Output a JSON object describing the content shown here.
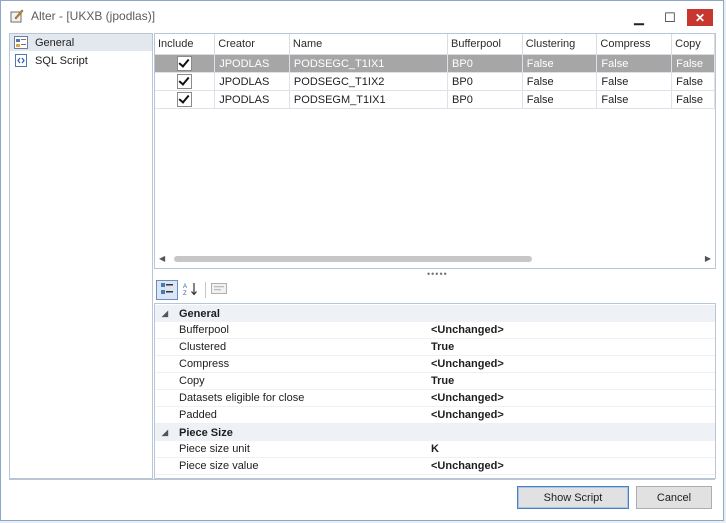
{
  "window": {
    "title": "Alter - [UKXB (jpodlas)]",
    "controls": {
      "minimize": "▁",
      "maximize": "☐",
      "close": "✕"
    }
  },
  "nav": {
    "items": [
      {
        "label": "General",
        "icon": "properties-icon",
        "selected": true
      },
      {
        "label": "SQL Script",
        "icon": "script-icon",
        "selected": false
      }
    ]
  },
  "grid": {
    "columns": [
      "Include",
      "Creator",
      "Name",
      "Bufferpool",
      "Clustering",
      "Compress",
      "Copy"
    ],
    "rows": [
      {
        "include": true,
        "creator": "JPODLAS",
        "name": "PODSEGC_T1IX1",
        "bufferpool": "BP0",
        "clustering": "False",
        "compress": "False",
        "copy": "False",
        "selected": true
      },
      {
        "include": true,
        "creator": "JPODLAS",
        "name": "PODSEGC_T1IX2",
        "bufferpool": "BP0",
        "clustering": "False",
        "compress": "False",
        "copy": "False",
        "selected": false
      },
      {
        "include": true,
        "creator": "JPODLAS",
        "name": "PODSEGM_T1IX1",
        "bufferpool": "BP0",
        "clustering": "False",
        "compress": "False",
        "copy": "False",
        "selected": false
      }
    ]
  },
  "splitter": "•••••",
  "property_grid": {
    "categories": [
      {
        "name": "General",
        "expander": "◢",
        "props": [
          {
            "name": "Bufferpool",
            "value": "<Unchanged>"
          },
          {
            "name": "Clustered",
            "value": "True"
          },
          {
            "name": "Compress",
            "value": "<Unchanged>"
          },
          {
            "name": "Copy",
            "value": "True"
          },
          {
            "name": "Datasets eligible for close",
            "value": "<Unchanged>"
          },
          {
            "name": "Padded",
            "value": "<Unchanged>"
          }
        ]
      },
      {
        "name": "Piece Size",
        "expander": "◢",
        "props": [
          {
            "name": "Piece size unit",
            "value": "K"
          },
          {
            "name": "Piece size value",
            "value": "<Unchanged>"
          }
        ]
      }
    ]
  },
  "buttons": {
    "show_script": "Show Script",
    "cancel": "Cancel"
  },
  "colors": {
    "close": "#c7372f",
    "selected_row": "#a6a6a6",
    "border": "#b9c6d6"
  }
}
